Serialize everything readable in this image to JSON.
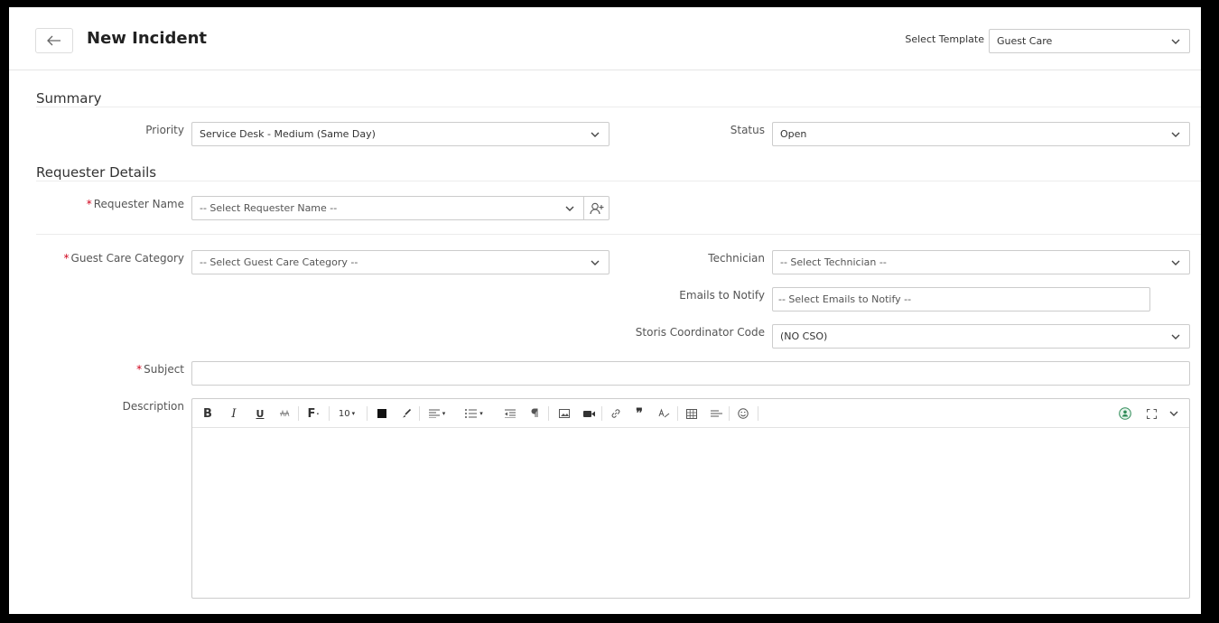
{
  "header": {
    "title": "New Incident",
    "template_label": "Select Template",
    "template_value": "Guest Care"
  },
  "summary": {
    "heading": "Summary",
    "priority_label": "Priority",
    "priority_value": "Service Desk - Medium (Same Day)",
    "status_label": "Status",
    "status_value": "Open"
  },
  "requester": {
    "heading": "Requester Details",
    "name_label": "Requester Name",
    "name_placeholder": "-- Select Requester Name --"
  },
  "details": {
    "category_label": "Guest Care Category",
    "category_placeholder": "-- Select Guest Care Category --",
    "technician_label": "Technician",
    "technician_placeholder": "-- Select Technician --",
    "emails_label": "Emails to Notify",
    "emails_placeholder": "-- Select Emails to Notify --",
    "coordinator_label": "Storis Coordinator Code",
    "coordinator_value": "(NO CSO)",
    "subject_label": "Subject",
    "subject_value": "",
    "description_label": "Description"
  },
  "toolbar": {
    "bold": "B",
    "italic": "I",
    "underline": "U",
    "font_family": "F",
    "font_size": "10"
  },
  "required_marker": "*",
  "colors": {
    "required": "#d0021b",
    "border": "#cccccc",
    "accent_green": "#2e8b57"
  }
}
